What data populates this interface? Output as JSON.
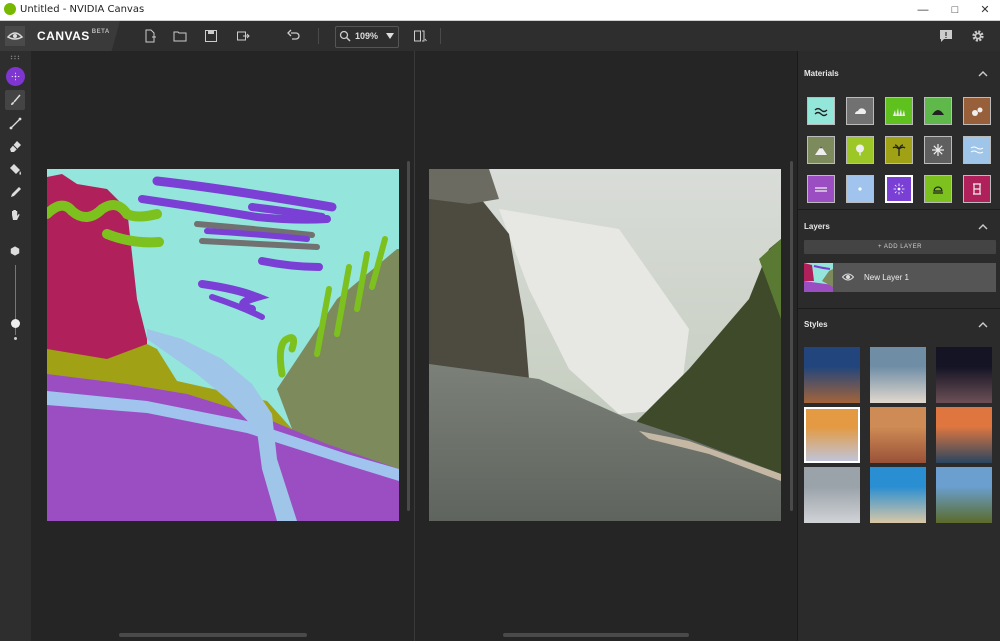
{
  "window": {
    "title": "Untitled - NVIDIA Canvas"
  },
  "app": {
    "name": "CANVAS",
    "tag": "BETA",
    "logo_text": "NVIDIA"
  },
  "toolbar": {
    "zoom": "109%"
  },
  "panel": {
    "materials_title": "Materials",
    "layers_title": "Layers",
    "styles_title": "Styles",
    "add_layer_label": "+ ADD LAYER",
    "layer_name": "New Layer 1"
  },
  "materials": [
    {
      "name": "sea",
      "color": "#93e6da",
      "icon": "waves-icon"
    },
    {
      "name": "cloud",
      "color": "#717171",
      "icon": "cloud-icon"
    },
    {
      "name": "grass",
      "color": "#5fc11e",
      "icon": "grass-icon"
    },
    {
      "name": "hill",
      "color": "#5fb84a",
      "icon": "hill-icon"
    },
    {
      "name": "dirt",
      "color": "#97603b",
      "icon": "rocks-icon"
    },
    {
      "name": "mountain",
      "color": "#7d8a5c",
      "icon": "mountain-icon"
    },
    {
      "name": "tree",
      "color": "#9cc726",
      "icon": "tree-icon"
    },
    {
      "name": "palm",
      "color": "#a1a115",
      "icon": "palm-icon"
    },
    {
      "name": "snow",
      "color": "#5f5f5f",
      "icon": "snowflake-icon"
    },
    {
      "name": "river",
      "color": "#9fc5e8",
      "icon": "river-icon"
    },
    {
      "name": "stone",
      "color": "#9b4dc2",
      "icon": "lines-icon"
    },
    {
      "name": "fog",
      "color": "#a0c4ee",
      "icon": "dot-icon"
    },
    {
      "name": "sky",
      "color": "#7a3fd4",
      "icon": "sparkle-icon"
    },
    {
      "name": "sand",
      "color": "#7dc11e",
      "icon": "dome-icon"
    },
    {
      "name": "building",
      "color": "#b0205b",
      "icon": "tower-icon"
    }
  ],
  "styles": [
    {
      "top": "#22457d",
      "bottom": "#a3643a"
    },
    {
      "top": "#6f8ea6",
      "bottom": "#e1d8cd"
    },
    {
      "top": "#141424",
      "bottom": "#6d5056"
    },
    {
      "top": "#e39a43",
      "bottom": "#c0c4d8"
    },
    {
      "top": "#cf8b55",
      "bottom": "#9a5238"
    },
    {
      "top": "#df7640",
      "bottom": "#2a4660"
    },
    {
      "top": "#9aa2aa",
      "bottom": "#d1d3d6"
    },
    {
      "top": "#2a8ed2",
      "bottom": "#d8c7a6"
    },
    {
      "top": "#6a9fcf",
      "bottom": "#5b6b2a"
    }
  ]
}
